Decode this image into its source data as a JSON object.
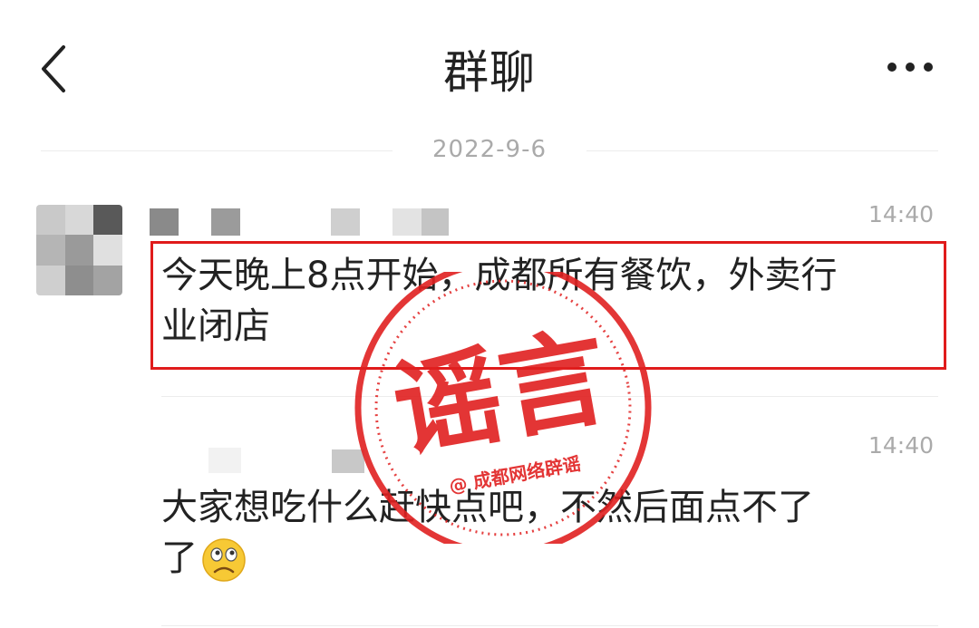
{
  "header": {
    "back_icon": "chevron-left-icon",
    "title": "群聊",
    "more_icon": "more-dots-icon"
  },
  "date_divider": "2022-9-6",
  "messages": [
    {
      "time": "14:40",
      "text_line1": "今天晚上8点开始，成都所有餐饮，外卖行",
      "text_line2": "业闭店",
      "highlighted": true
    },
    {
      "time": "14:40",
      "text_line1": "大家想吃什么赶快点吧，不然后面点不了",
      "text_line2": "了",
      "emoji": "frowning-face-emoji"
    }
  ],
  "stamp": {
    "main_text": "谣言",
    "sub_text": "@ 成都网络辟谣",
    "color": "#e02020"
  },
  "colors": {
    "highlight_border": "#e01b1b",
    "meta_gray": "#aaaaaa",
    "text": "#222222"
  }
}
